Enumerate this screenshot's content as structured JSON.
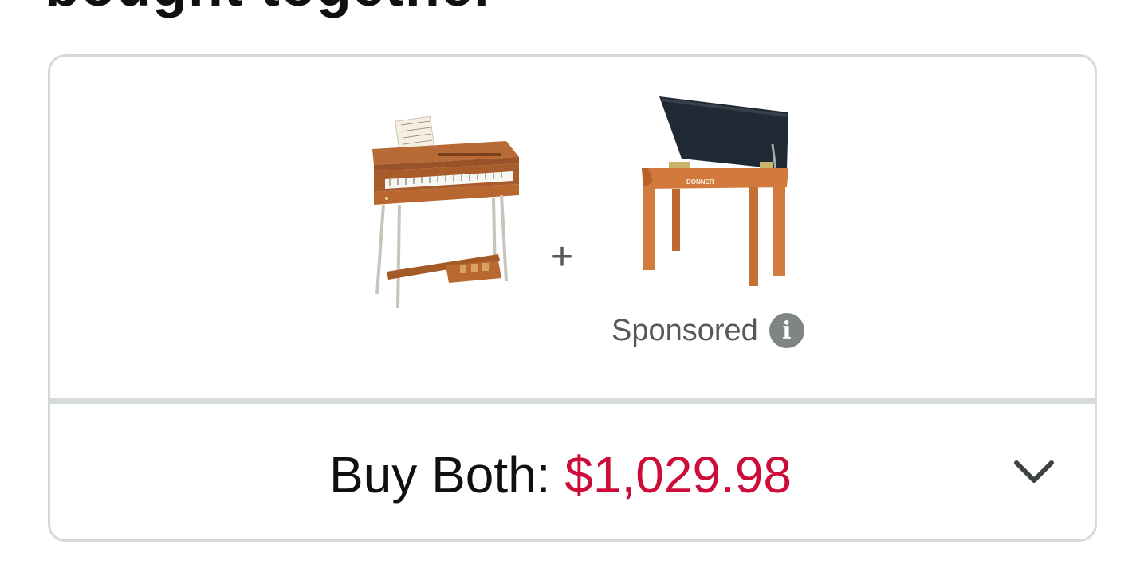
{
  "section": {
    "title": "bought together"
  },
  "bundle": {
    "products": [
      {
        "name": "piano-image"
      },
      {
        "name": "bench-image"
      }
    ],
    "plus_symbol": "+",
    "sponsored_label": "Sponsored",
    "info_symbol": "i",
    "buy_label": "Buy Both: ",
    "buy_price": "$1,029.98"
  },
  "colors": {
    "price": "#cc0c39",
    "text": "#0f1111",
    "border": "#d5d9d9",
    "muted": "#565959"
  },
  "icons": {
    "info": "info-icon",
    "expand": "chevron-down-icon"
  }
}
